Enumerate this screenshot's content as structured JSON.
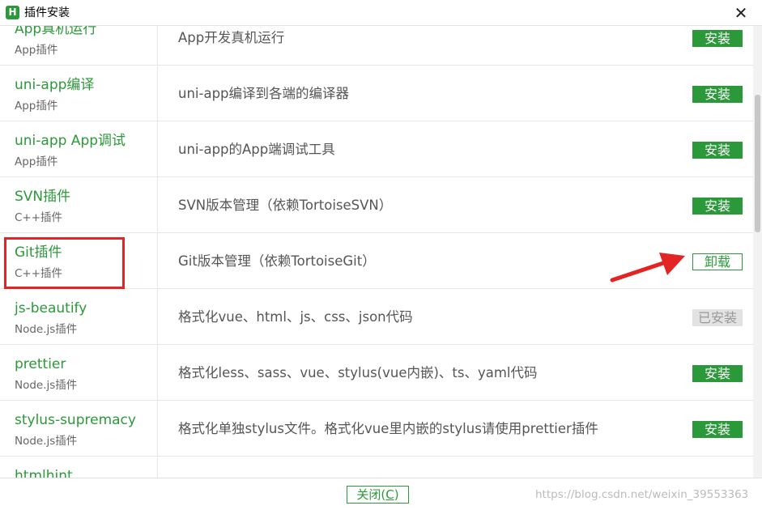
{
  "window": {
    "title": "插件安装",
    "logo_letter": "H",
    "close_glyph": "✕"
  },
  "colors": {
    "accent_green": "#2b9939",
    "annotation_red": "#e22424"
  },
  "plugins": [
    {
      "name": "App真机运行",
      "type": "App插件",
      "description": "App开发真机运行",
      "action": "安装",
      "state": "install"
    },
    {
      "name": "uni-app编译",
      "type": "App插件",
      "description": "uni-app编译到各端的编译器",
      "action": "安装",
      "state": "install"
    },
    {
      "name": "uni-app App调试",
      "type": "App插件",
      "description": "uni-app的App端调试工具",
      "action": "安装",
      "state": "install"
    },
    {
      "name": "SVN插件",
      "type": "C++插件",
      "description": "SVN版本管理（依赖TortoiseSVN）",
      "action": "安装",
      "state": "install"
    },
    {
      "name": "Git插件",
      "type": "C++插件",
      "description": "Git版本管理（依赖TortoiseGit）",
      "action": "卸载",
      "state": "uninstall"
    },
    {
      "name": "js-beautify",
      "type": "Node.js插件",
      "description": "格式化vue、html、js、css、json代码",
      "action": "已安装",
      "state": "installed"
    },
    {
      "name": "prettier",
      "type": "Node.js插件",
      "description": "格式化less、sass、vue、stylus(vue内嵌)、ts、yaml代码",
      "action": "安装",
      "state": "install"
    },
    {
      "name": "stylus-supremacy",
      "type": "Node.js插件",
      "description": "格式化单独stylus文件。格式化vue里内嵌的stylus请使用prettier插件",
      "action": "安装",
      "state": "install"
    },
    {
      "name": "htmlhint",
      "type": "",
      "description": "",
      "action": "",
      "state": "none"
    }
  ],
  "footer": {
    "close_label": "关闭",
    "close_shortcut_open": "(",
    "close_shortcut_key": "C",
    "close_shortcut_close": ")",
    "watermark": "https://blog.csdn.net/weixin_39553363"
  }
}
